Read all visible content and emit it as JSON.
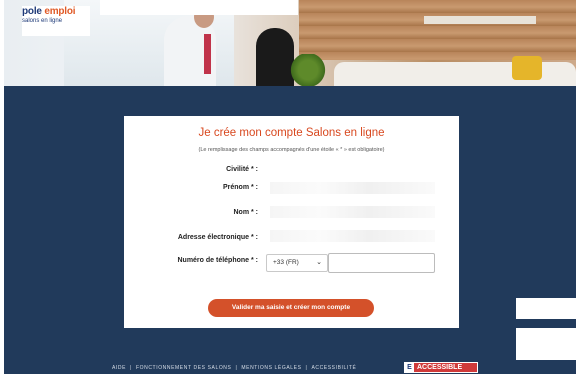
{
  "logo": {
    "main_a": "pole ",
    "main_b": "emploi",
    "sub": "salons en ligne"
  },
  "form": {
    "title": "Je crée mon compte Salons en ligne",
    "note": "(Le remplissage des champs accompagnés d'une étoile « * » est obligatoire)",
    "fields": {
      "civilite": "Civilité * :",
      "prenom": "Prénom * :",
      "nom": "Nom * :",
      "email": "Adresse électronique * :",
      "phone": "Numéro de téléphone * :"
    },
    "phone_prefix": "+33 (FR)",
    "submit_label": "Valider ma saisie et créer mon compte"
  },
  "footer": {
    "links": [
      "AIDE",
      "FONCTIONNEMENT DES SALONS",
      "MENTIONS LÉGALES",
      "ACCESSIBILITÉ"
    ],
    "separator": "|",
    "badge_letter": "E",
    "badge_label": "ACCESSIBLE"
  },
  "colors": {
    "accent": "#d4512a",
    "navy": "#213a5b",
    "title": "#d8481f"
  },
  "icons": {
    "dropdown": "chevron-down-icon"
  }
}
